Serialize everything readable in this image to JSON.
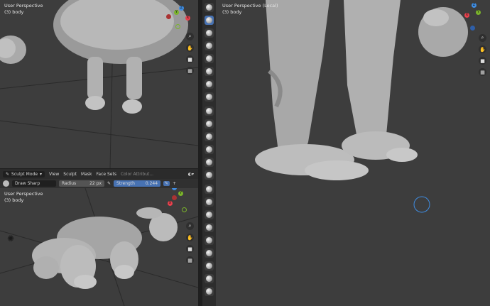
{
  "viewports": {
    "top_left": {
      "title": "User Perspective",
      "subtitle": "(3) body"
    },
    "bottom_left": {
      "title": "User Perspective",
      "subtitle": "(3) body"
    },
    "right": {
      "title": "User Perspective (Local)",
      "subtitle": "(3) body"
    }
  },
  "header": {
    "mode": "Sculpt Mode",
    "menus": [
      "View",
      "Sculpt",
      "Mask",
      "Face Sets",
      "Color Attribut..."
    ]
  },
  "tool_settings": {
    "brush": "Draw Sharp",
    "radius_label": "Radius",
    "radius_value": "22 px",
    "strength_label": "Strength",
    "strength_value": "0.244"
  },
  "gizmo_axes": {
    "x": "X",
    "y": "Y",
    "z": "Z"
  },
  "colors": {
    "bg": "#3d3d3d",
    "toolbar": "#2d2d2d",
    "accent": "#4772b3",
    "axis_x": "#e8414d",
    "axis_y": "#7ab32b",
    "axis_z": "#3f8ce0"
  }
}
